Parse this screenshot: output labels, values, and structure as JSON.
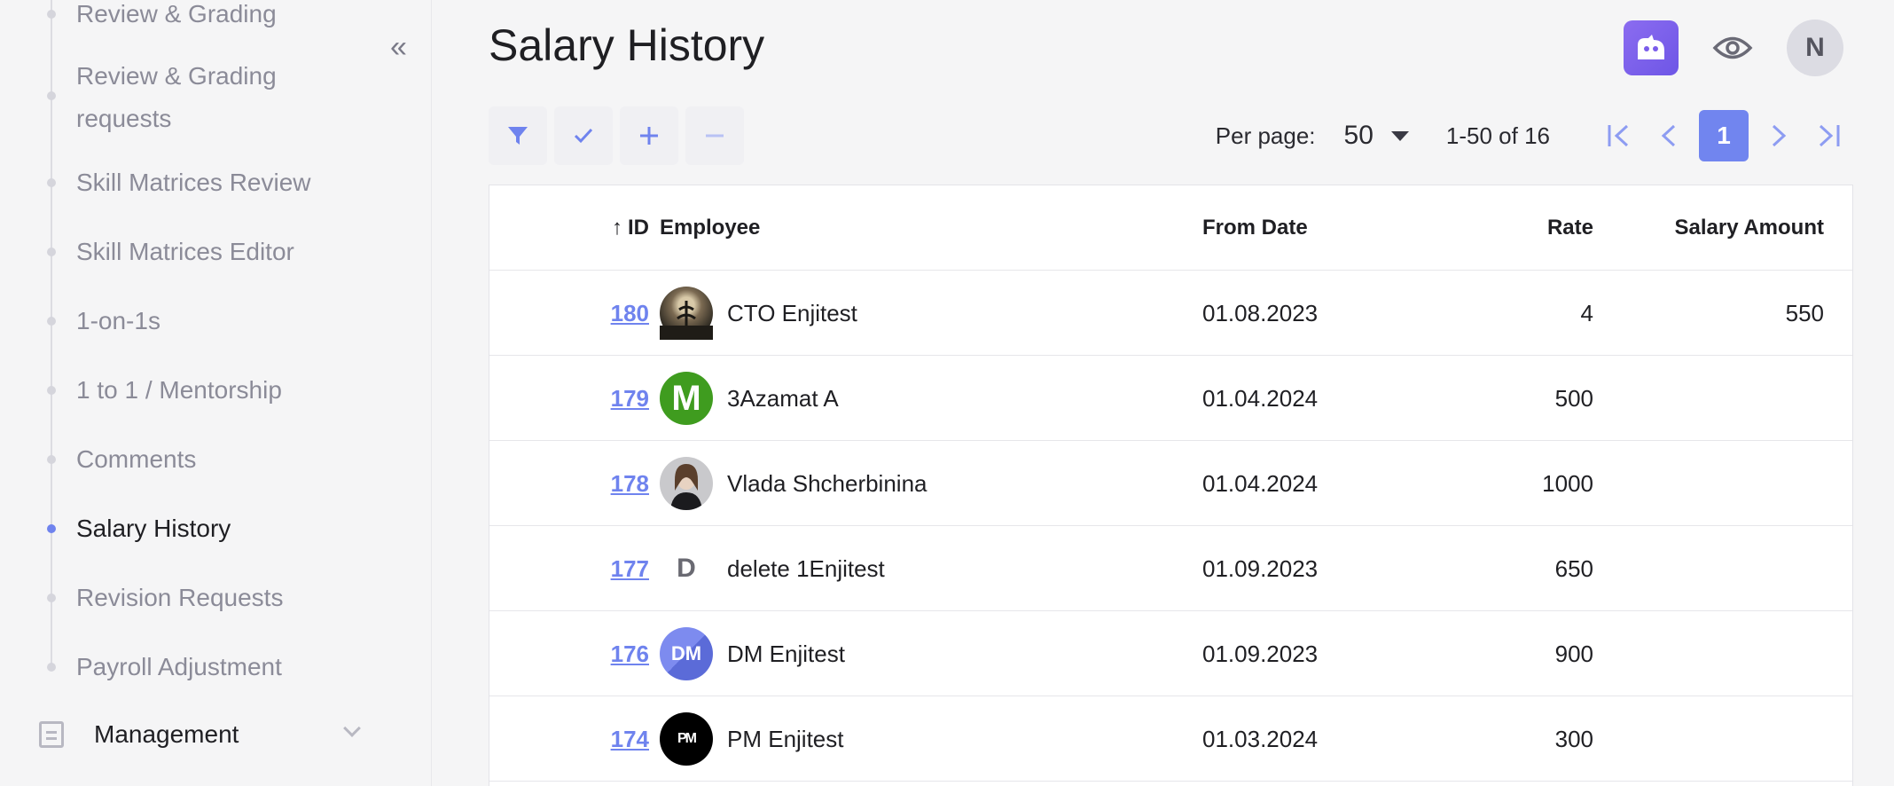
{
  "sidebar": {
    "items": [
      {
        "label": "Review & Grading"
      },
      {
        "label": "Review & Grading requests"
      },
      {
        "label": "Skill Matrices Review"
      },
      {
        "label": "Skill Matrices Editor"
      },
      {
        "label": "1-on-1s"
      },
      {
        "label": "1 to 1 / Mentorship"
      },
      {
        "label": "Comments"
      },
      {
        "label": "Salary History"
      },
      {
        "label": "Revision Requests"
      },
      {
        "label": "Payroll Adjustment"
      }
    ],
    "section": {
      "label": "Management"
    },
    "collapse_label": "«"
  },
  "header": {
    "title": "Salary History",
    "user_initial": "N"
  },
  "pagination": {
    "per_page_label": "Per page:",
    "per_page_value": "50",
    "range": "1-50 of 16",
    "current_page": "1"
  },
  "table": {
    "columns": {
      "id": "ID",
      "employee": "Employee",
      "from_date": "From Date",
      "rate": "Rate",
      "salary_amount": "Salary Amount"
    },
    "rows": [
      {
        "id": "180",
        "employee": "CTO Enjitest",
        "from_date": "01.08.2023",
        "rate": "4",
        "salary_amount": "550",
        "avatar": "photo-landscape"
      },
      {
        "id": "179",
        "employee": "3Azamat A",
        "from_date": "01.04.2024",
        "rate": "500",
        "salary_amount": "",
        "avatar": "letter-m-green",
        "avatar_text": "M"
      },
      {
        "id": "178",
        "employee": "Vlada Shcherbinina",
        "from_date": "01.04.2024",
        "rate": "1000",
        "salary_amount": "",
        "avatar": "photo-person"
      },
      {
        "id": "177",
        "employee": "delete 1Enjitest",
        "from_date": "01.09.2023",
        "rate": "650",
        "salary_amount": "",
        "avatar": "letter-d",
        "avatar_text": "D"
      },
      {
        "id": "176",
        "employee": "DM Enjitest",
        "from_date": "01.09.2023",
        "rate": "900",
        "salary_amount": "",
        "avatar": "letter-dm-blue",
        "avatar_text": "DM"
      },
      {
        "id": "174",
        "employee": "PM Enjitest",
        "from_date": "01.03.2024",
        "rate": "300",
        "salary_amount": "",
        "avatar": "logo-pm-black",
        "avatar_text": "PM"
      }
    ]
  },
  "colors": {
    "accent": "#6f83ee",
    "active_dot": "#6f83ee",
    "logo": "#7a5cea"
  }
}
